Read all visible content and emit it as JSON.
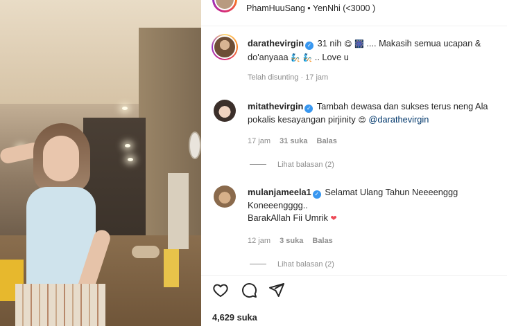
{
  "header": {
    "audio": "PhamHuuSang • YenNhi (<3000 )"
  },
  "caption": {
    "username": "darathevirgin",
    "text_before_emoji": "31 nih",
    "emoji_1": "😋",
    "emoji_2": "🎆",
    "text_mid": ".... Makasih semua ucapan & do'anyaaa",
    "emoji_3": "🧞",
    "emoji_4": "🧞",
    "text_end": ".. Love u",
    "edited": "Telah disunting · 17 jam"
  },
  "comments": [
    {
      "username": "mitathevirgin",
      "text": "Tambah dewasa dan sukses terus neng Ala pokalis kesayangan pirjinity",
      "emoji": "😍",
      "mention": "@darathevirgin",
      "time": "17 jam",
      "likes": "31 suka",
      "reply": "Balas",
      "view_replies": "Lihat balasan (2)"
    },
    {
      "username": "mulanjameela1",
      "line1": "Selamat Ulang Tahun Neeeenggg",
      "line2": "Koneeengggg..",
      "line3": "BarakAllah Fii Umrik",
      "emoji": "❤",
      "time": "12 jam",
      "likes": "3 suka",
      "reply": "Balas",
      "view_replies": "Lihat balasan (2)"
    }
  ],
  "footer": {
    "likes": "4,629 suka"
  },
  "icons": {
    "like": "heart-icon",
    "comment": "comment-icon",
    "share": "share-icon",
    "verified": "verified-badge-icon"
  },
  "colors": {
    "verified": "#3897f0",
    "mention": "#00376b",
    "muted": "#8e8e8e",
    "heart_red": "#ed4956"
  }
}
